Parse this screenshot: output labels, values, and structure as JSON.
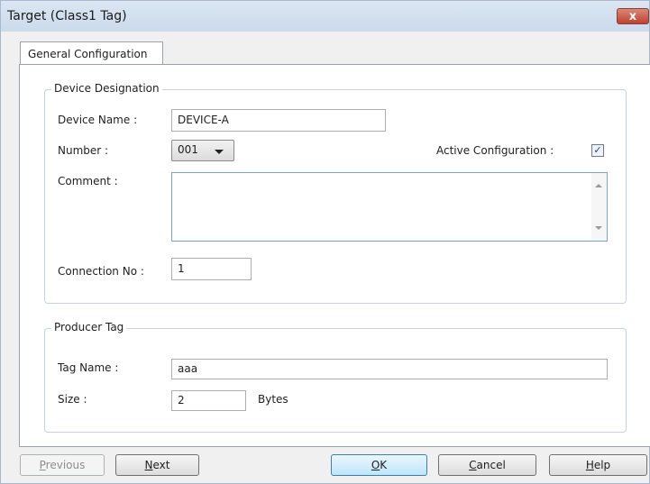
{
  "window": {
    "title": "Target (Class1 Tag)",
    "close_glyph": "x"
  },
  "tabs": [
    {
      "label": "General Configuration"
    }
  ],
  "device_designation": {
    "legend": "Device Designation",
    "device_name_label": "Device Name :",
    "device_name_value": "DEVICE-A",
    "number_label": "Number :",
    "number_value": "001",
    "active_configuration_label": "Active Configuration :",
    "active_configuration_checked": true,
    "comment_label": "Comment :",
    "comment_value": "",
    "connection_no_label": "Connection No :",
    "connection_no_value": "1"
  },
  "producer_tag": {
    "legend": "Producer Tag",
    "tag_name_label": "Tag Name :",
    "tag_name_value": "aaa",
    "size_label": "Size :",
    "size_value": "2",
    "size_unit": "Bytes"
  },
  "buttons": {
    "previous": {
      "mnemonic": "P",
      "rest": "revious",
      "enabled": false
    },
    "next": {
      "mnemonic": "N",
      "rest": "ext",
      "enabled": true
    },
    "ok": {
      "mnemonic": "O",
      "rest": "K",
      "enabled": true
    },
    "cancel": {
      "mnemonic": "C",
      "rest": "ancel",
      "enabled": true
    },
    "help": {
      "mnemonic": "H",
      "rest": "elp",
      "enabled": true
    }
  },
  "colors": {
    "title_bar": "#cbdaec",
    "close_button": "#c0412f",
    "checkbox_mark": "#1f3f8f"
  }
}
